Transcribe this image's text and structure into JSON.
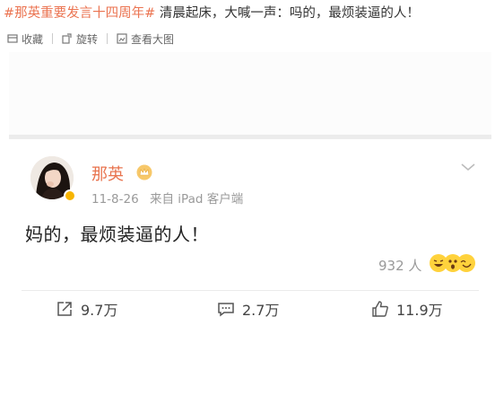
{
  "post": {
    "hashtag": "#那英重要发言十四周年#",
    "text": " 清晨起床，大喊一声：吗的，最烦装逼的人！"
  },
  "toolbar": {
    "collect": "收藏",
    "rotate": "旋转",
    "view_large": "查看大图"
  },
  "screenshot": {
    "username": "那英",
    "date": "11-8-26",
    "source": "来自 iPad 客户端",
    "content": "妈的，最烦装逼的人！",
    "likes_label": "932 人",
    "repost": "9.7万",
    "comment": "2.7万",
    "like": "11.9万"
  },
  "colors": {
    "hashtag": "#eb7350",
    "username": "#e8744f",
    "meta": "#9a9a9a"
  }
}
